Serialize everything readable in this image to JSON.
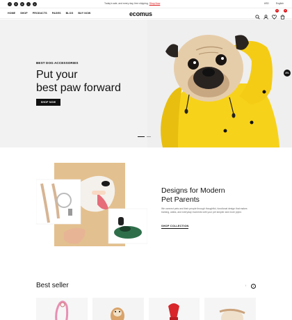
{
  "topbar": {
    "social": [
      "f",
      "X",
      "in",
      "♪",
      "p"
    ],
    "announce_text": "Today's sale, and every day, free shipping.",
    "announce_link": "Shop Now",
    "currency": "USD",
    "language": "English"
  },
  "nav": {
    "menu": [
      "HOME",
      "SHOP",
      "PRODUCTS",
      "PAGES",
      "BLOG",
      "BUY NOW"
    ],
    "logo": "ecomus",
    "cart_count": "0",
    "wishlist_count": "0"
  },
  "hero": {
    "subtitle": "BEST DOG ACCESSORIES",
    "title_line1": "Put your",
    "title_line2": "best paw forward",
    "button": "SHOP NOW",
    "badge": "4%"
  },
  "designs": {
    "title_line1": "Designs for Modern",
    "title_line2": "Pet Parents",
    "text": "We connect pets and their people through thoughtful, functional design that makes training, walks, and everyday moments with your pet simpler and more joyful.",
    "link": "SHOP COLLECTION"
  },
  "bestseller": {
    "title": "Best seller",
    "prev": "‹",
    "next": "›"
  },
  "colors": {
    "accent": "#db1215",
    "hero_bg": "#f2f2f2",
    "raincoat": "#f7d21a"
  }
}
